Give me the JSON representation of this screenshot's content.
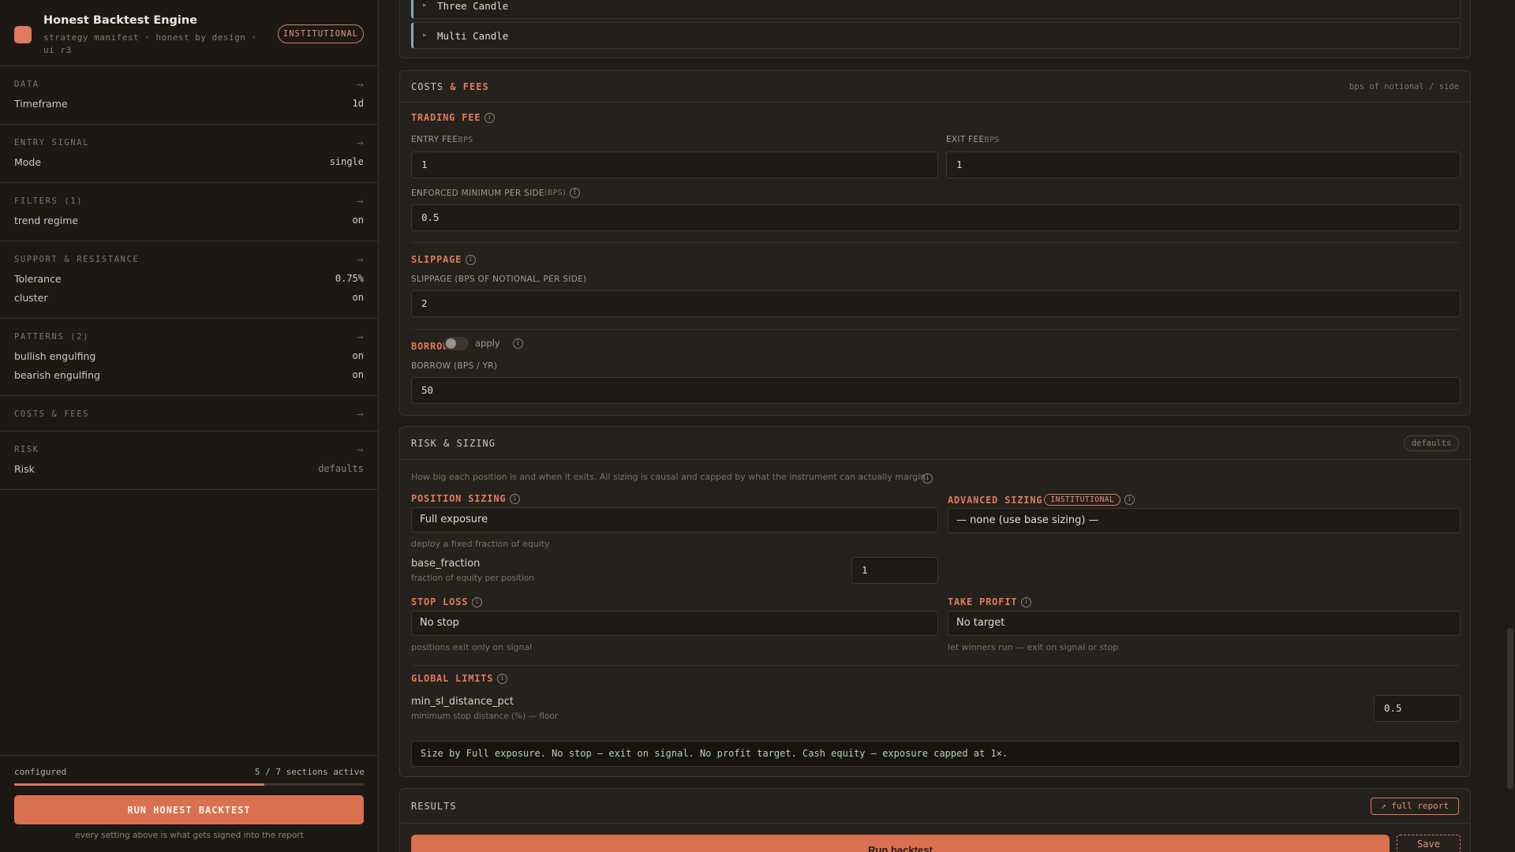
{
  "brand": {
    "title": "Honest Backtest Engine",
    "subtitle": "strategy manifest · honest by design · ui r3",
    "badge": "INSTITUTIONAL"
  },
  "sidebar": {
    "arrow": "→",
    "sections": [
      {
        "title": "DATA",
        "rows": [
          {
            "label": "Timeframe",
            "value": "1d"
          }
        ]
      },
      {
        "title": "ENTRY SIGNAL",
        "rows": [
          {
            "label": "Mode",
            "value": "single"
          }
        ]
      },
      {
        "title": "FILTERS (1)",
        "rows": [
          {
            "label": "trend regime",
            "value": "on"
          }
        ]
      },
      {
        "title": "SUPPORT & RESISTANCE",
        "rows": [
          {
            "label": "Tolerance",
            "value": "0.75%"
          },
          {
            "label": "cluster",
            "value": "on"
          }
        ]
      },
      {
        "title": "PATTERNS (2)",
        "rows": [
          {
            "label": "bullish engulfing",
            "value": "on"
          },
          {
            "label": "bearish engulfing",
            "value": "on"
          }
        ]
      },
      {
        "title": "COSTS & FEES",
        "rows": []
      },
      {
        "title": "RISK",
        "rows": [
          {
            "label": "Risk",
            "value": "defaults"
          }
        ]
      }
    ],
    "footer": {
      "status": "configured",
      "count": "5 / 7 sections active",
      "progress": 0.714,
      "run_label": "RUN HONEST BACKTEST",
      "note": "every setting above is what gets signed into the report"
    }
  },
  "patterns_card": {
    "rows": [
      {
        "arrow": "▸",
        "name": "Three Candle"
      },
      {
        "arrow": "▸",
        "name": "Multi Candle"
      }
    ]
  },
  "costs": {
    "title_plain": "COSTS",
    "title_accent": "& FEES",
    "note": "bps of notional / side",
    "trading_fee": {
      "label": "TRADING FEE",
      "entry_label": "ENTRY FEE",
      "entry_unit": "BPS",
      "entry_value": "1",
      "exit_label": "EXIT FEE",
      "exit_unit": "BPS",
      "exit_value": "1",
      "min_label": "ENFORCED MINIMUM PER SIDE",
      "min_unit": "(BPS)",
      "min_value": "0.5"
    },
    "slippage": {
      "label": "SLIPPAGE",
      "field_label": "SLIPPAGE (BPS OF NOTIONAL, PER SIDE)",
      "value": "2"
    },
    "borrow": {
      "label": "BORROW",
      "toggle_label": "apply",
      "toggle_on": false,
      "field_label": "BORROW (BPS / YR)",
      "value": "50"
    }
  },
  "risk": {
    "title": "RISK & SIZING",
    "badge": "defaults",
    "description": "How big each position is and when it exits. All sizing is causal and capped by what the instrument can actually margin.",
    "position_sizing": {
      "label": "POSITION SIZING",
      "value": "Full exposure",
      "hint": "deploy a fixed fraction of equity",
      "param_name": "base_fraction",
      "param_hint": "fraction of equity per position",
      "param_value": "1"
    },
    "advanced_sizing": {
      "label": "ADVANCED SIZING",
      "badge": "INSTITUTIONAL",
      "value": "— none (use base sizing) —"
    },
    "stop_loss": {
      "label": "STOP LOSS",
      "value": "No stop",
      "hint": "positions exit only on signal"
    },
    "take_profit": {
      "label": "TAKE PROFIT",
      "value": "No target",
      "hint": "let winners run — exit on signal or stop"
    },
    "global_limits": {
      "label": "GLOBAL LIMITS",
      "param_name": "min_sl_distance_pct",
      "param_hint": "minimum stop distance (%) — floor",
      "param_value": "0.5"
    },
    "summary": "Size by Full exposure. No stop — exit on signal. No profit target. Cash equity — exposure capped at 1×."
  },
  "results": {
    "title": "RESULTS",
    "full_report": "↗ full report",
    "run_label": "Run backtest",
    "save_label": "Save report"
  },
  "colors": {
    "accent": "#e07b5b",
    "background": "#1f1b17",
    "panel": "#25211c",
    "pattern_stripe": "#7fa6c8",
    "summary_text": "#b9d2b0"
  }
}
